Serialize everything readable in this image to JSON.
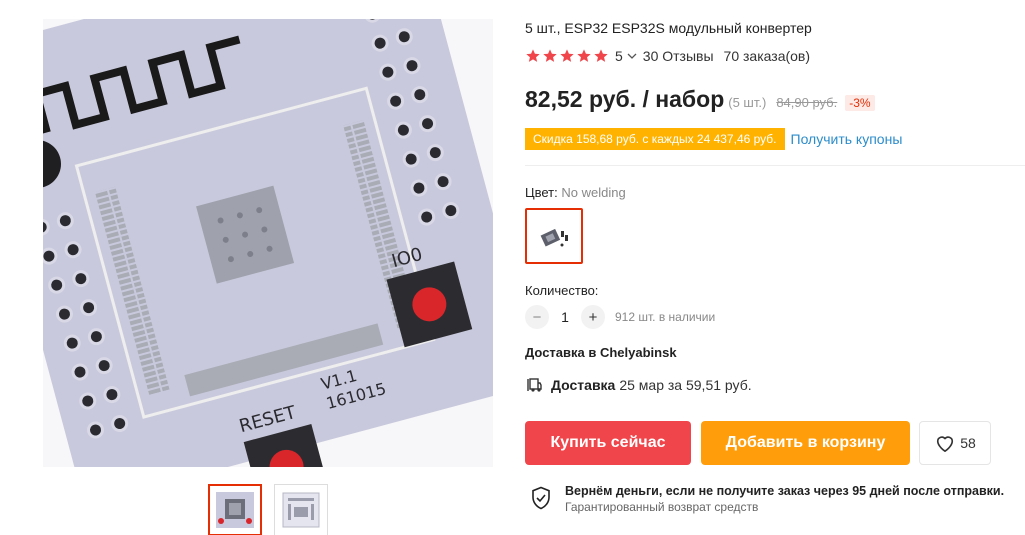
{
  "product": {
    "title": "5 шт., ESP32 ESP32S модульный конвертер",
    "rating": "5",
    "reviews": "30 Отзывы",
    "orders": "70 заказа(ов)",
    "price": "82,52 руб. / набор",
    "unit": "(5 шт.)",
    "old_price": "84,90 руб.",
    "discount": "-3%",
    "promo": "Скидка 158,68 руб. с каждых 24 437,46 руб.",
    "coupon_link": "Получить купоны"
  },
  "options": {
    "color_label": "Цвет:",
    "color_value": "No welding",
    "quantity_label": "Количество:",
    "quantity_minus": "−",
    "quantity": "1",
    "quantity_plus": "+",
    "stock": "912 шт. в наличии"
  },
  "delivery": {
    "destination": "Доставка в Chelyabinsk",
    "label": "Доставка",
    "details": "25 мар за 59,51 руб."
  },
  "actions": {
    "buy_now": "Купить сейчас",
    "add_to_cart": "Добавить в корзину",
    "wishlist_count": "58"
  },
  "guarantee": {
    "line1": "Вернём деньги, если не получите заказ через 95 дней после отправки.",
    "line2": "Гарантированный возврат средств"
  },
  "image_text": {
    "reset": "RESET",
    "io0": "IO0",
    "version": "V1.1",
    "date": "161015"
  },
  "icons": {
    "star": "star-icon",
    "chevron": "chevron-down-icon",
    "truck": "truck-icon",
    "heart": "heart-icon",
    "shield": "shield-check-icon"
  },
  "colors": {
    "star": "#f0454a",
    "buy": "#f0454a",
    "cart": "#ff9d0b",
    "promo": "#ffb300",
    "link": "#2b8dcc",
    "accent": "#e62e04"
  }
}
